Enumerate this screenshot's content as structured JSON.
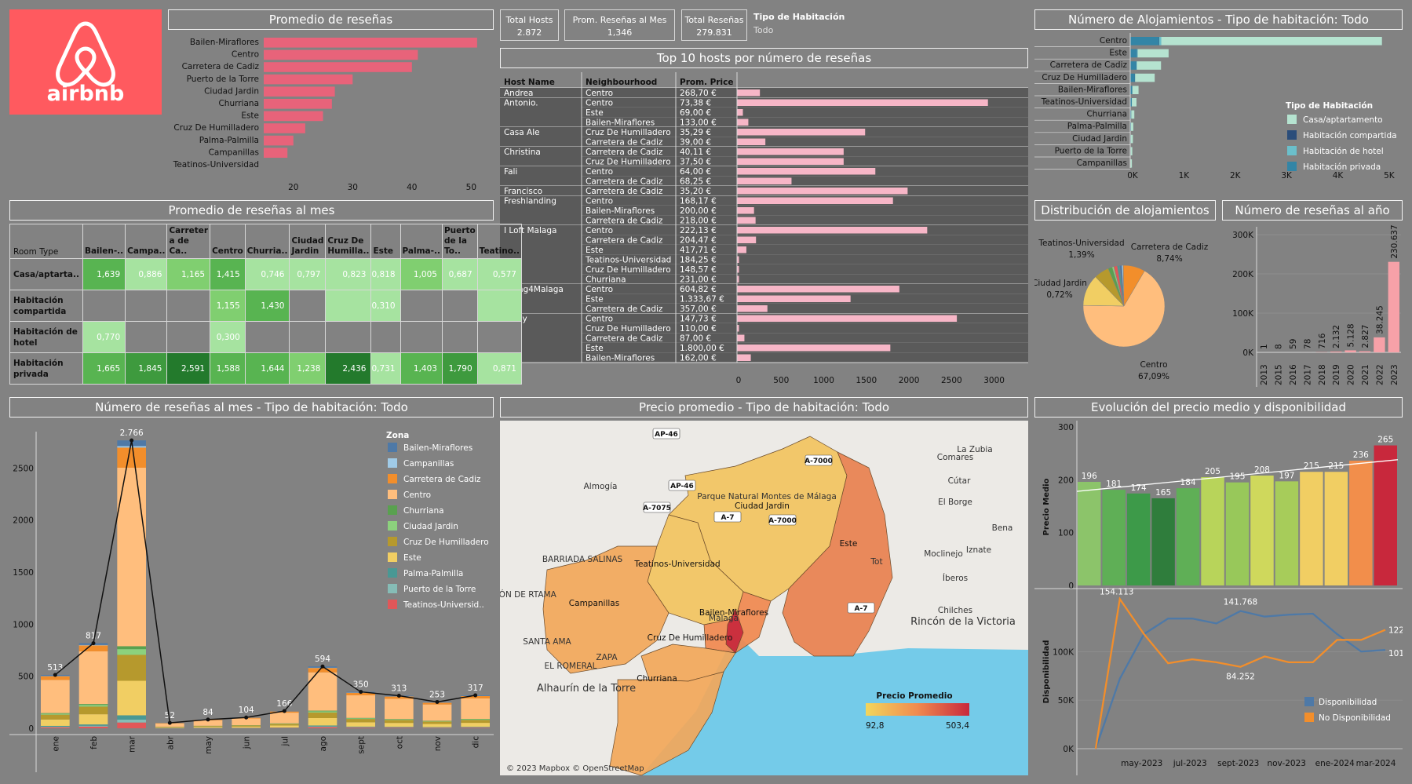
{
  "logo": {
    "text": "airbnb",
    "bg": "#ff5a5f"
  },
  "kpis": [
    {
      "label": "Total Hosts",
      "value": "2.872"
    },
    {
      "label": "Prom. Reseñas al Mes",
      "value": "1,346"
    },
    {
      "label": "Total Reseñas",
      "value": "279.831"
    }
  ],
  "room_filter": {
    "label": "Tipo de Habitación",
    "value": "Todo"
  },
  "panels": {
    "avg_reviews": "Promedio de reseñas",
    "avg_reviews_month": "Promedio de reseñas al mes",
    "reviews_month": "Número de reseñas al mes - Tipo de habitación: Todo",
    "top_hosts": "Top 10 hosts por número de reseñas",
    "map": "Precio promedio - Tipo de habitación: Todo",
    "accommodations": "Número de Alojamientos - Tipo de habitación: Todo",
    "distribution": "Distribución de alojamientos",
    "reviews_year": "Número de reseñas al año",
    "price_evolution": "Evolución del precio medio y disponibilidad"
  },
  "chart_data": [
    {
      "id": "avg_reviews",
      "type": "bar",
      "orientation": "horizontal",
      "categories": [
        "Bailen-Miraflores",
        "Centro",
        "Carretera de Cadiz",
        "Puerto de la Torre",
        "Ciudad Jardin",
        "Churriana",
        "Este",
        "Cruz De Humilladero",
        "Palma-Palmilla",
        "Campanillas",
        "Teatinos-Universidad"
      ],
      "values": [
        51,
        41,
        40,
        30,
        27,
        26.5,
        25,
        22,
        20,
        19,
        15
      ],
      "xticks": [
        "20",
        "30",
        "40",
        "50"
      ],
      "xlim": [
        15,
        53
      ],
      "color": "#e8637a"
    },
    {
      "id": "reviews_month",
      "type": "bar",
      "stacked": true,
      "categories": [
        "ene",
        "feb",
        "mar",
        "abr",
        "may",
        "jun",
        "jul",
        "ago",
        "sept",
        "oct",
        "nov",
        "dic"
      ],
      "totals": [
        513,
        817,
        2766,
        52,
        84,
        104,
        166,
        594,
        350,
        313,
        253,
        317
      ],
      "total_labels": [
        "513",
        "817",
        "2.766",
        "52",
        "84",
        "104",
        "166",
        "594",
        "350",
        "313",
        "253",
        "317"
      ],
      "yticks": [
        "0",
        "500",
        "1000",
        "1500",
        "2000",
        "2500"
      ],
      "ylim": [
        0,
        2850
      ],
      "legend_title": "Zona",
      "series": [
        {
          "name": "Bailen-Miraflores",
          "color": "#4e79a7",
          "share": 0.02
        },
        {
          "name": "Campanillas",
          "color": "#a0cbe8",
          "share": 0.005
        },
        {
          "name": "Carretera de Cadiz",
          "color": "#f28e2b",
          "share": 0.07
        },
        {
          "name": "Centro",
          "color": "#ffbe7d",
          "share": 0.62
        },
        {
          "name": "Churriana",
          "color": "#59a14f",
          "share": 0.01
        },
        {
          "name": "Ciudad Jardin",
          "color": "#8cd17d",
          "share": 0.02
        },
        {
          "name": "Cruz De Humilladero",
          "color": "#b6992d",
          "share": 0.09
        },
        {
          "name": "Este",
          "color": "#f1ce63",
          "share": 0.12
        },
        {
          "name": "Palma-Palmilla",
          "color": "#499894",
          "share": 0.015
        },
        {
          "name": "Puerto de la Torre",
          "color": "#86bcb6",
          "share": 0.01
        },
        {
          "name": "Teatinos-Universid..",
          "color": "#e15759",
          "share": 0.02
        }
      ]
    },
    {
      "id": "top_hosts",
      "type": "bar",
      "orientation": "horizontal",
      "columns": [
        "Host Name",
        "Neighbourhood",
        "Prom. Price"
      ],
      "hosts": [
        {
          "name": "Andrea",
          "rows": [
            [
              "Centro",
              "268,70 €",
              268.7
            ]
          ]
        },
        {
          "name": "Antonio.",
          "rows": [
            [
              "Centro",
              "73,38 €",
              2946
            ],
            [
              "Este",
              "69,00 €",
              69
            ],
            [
              "Bailen-Miraflores",
              "133,00 €",
              133
            ]
          ]
        },
        {
          "name": "Casa Ale",
          "rows": [
            [
              "Cruz De Humilladero",
              "35,29 €",
              1504
            ],
            [
              "Carretera de Cadiz",
              "39,00 €",
              333
            ]
          ]
        },
        {
          "name": "Christina",
          "rows": [
            [
              "Carretera de Cadiz",
              "40,11 €",
              1252
            ],
            [
              "Cruz De Humilladero",
              "37,50 €",
              1252
            ]
          ]
        },
        {
          "name": "Fali",
          "rows": [
            [
              "Centro",
              "64,00 €",
              1624
            ],
            [
              "Carretera de Cadiz",
              "68,25 €",
              640
            ]
          ]
        },
        {
          "name": "Francisco",
          "rows": [
            [
              "Carretera de Cadiz",
              "35,20 €",
              2003
            ]
          ]
        },
        {
          "name": "Freshlanding",
          "rows": [
            [
              "Centro",
              "168,17 €",
              1831
            ],
            [
              "Bailen-Miraflores",
              "200,00 €",
              200
            ],
            [
              "Carretera de Cadiz",
              "218,00 €",
              218
            ]
          ]
        },
        {
          "name": "I Loft Malaga",
          "rows": [
            [
              "Centro",
              "222,13 €",
              2233
            ],
            [
              "Carretera de Cadiz",
              "204,47 €",
              223
            ],
            [
              "Este",
              "417,71 €",
              110
            ],
            [
              "Teatinos-Universidad",
              "184,25 €",
              23
            ],
            [
              "Cruz De Humilladero",
              "148,57 €",
              23
            ],
            [
              "Churriana",
              "231,00 €",
              23
            ]
          ]
        },
        {
          "name": "Living4Malaga",
          "rows": [
            [
              "Centro",
              "604,82 €",
              1906
            ],
            [
              "Este",
              "1.333,67 €",
              1333
            ],
            [
              "Carretera de Cadiz",
              "357,00 €",
              357
            ]
          ]
        },
        {
          "name": "Remy",
          "rows": [
            [
              "Centro",
              "147,73 €",
              2581
            ],
            [
              "Cruz De Humilladero",
              "110,00 €",
              23
            ],
            [
              "Carretera de Cadiz",
              "87,00 €",
              87
            ],
            [
              "Este",
              "1.800,00 €",
              1800
            ],
            [
              "Bailen-Miraflores",
              "162,00 €",
              162
            ]
          ]
        }
      ],
      "xticks": [
        "0",
        "500",
        "1000",
        "1500",
        "2000",
        "2500",
        "3000"
      ],
      "xlim": [
        0,
        3400
      ],
      "color": "#f7b6c7"
    },
    {
      "id": "accommodations",
      "type": "bar",
      "orientation": "horizontal",
      "stacked": true,
      "categories": [
        "Centro",
        "Este",
        "Carretera de Cadiz",
        "Cruz De Humilladero",
        "Bailen-Miraflores",
        "Teatinos-Universidad",
        "Churriana",
        "Palma-Palmilla",
        "Ciudad Jardin",
        "Puerto de la Torre",
        "Campanillas"
      ],
      "series": [
        {
          "name": "Casa/aptartamento",
          "color": "#b5e3d0",
          "values": [
            4300,
            600,
            470,
            380,
            120,
            90,
            60,
            45,
            40,
            30,
            25
          ]
        },
        {
          "name": "Habitación compartida",
          "color": "#2b4d7a",
          "values": [
            5,
            3,
            2,
            2,
            0,
            0,
            0,
            0,
            0,
            0,
            0
          ]
        },
        {
          "name": "Habitación de hotel",
          "color": "#6bbfcb",
          "values": [
            40,
            15,
            8,
            5,
            2,
            2,
            0,
            0,
            0,
            0,
            0
          ]
        },
        {
          "name": "Habitación privada",
          "color": "#3385a6",
          "values": [
            560,
            130,
            120,
            90,
            40,
            30,
            20,
            15,
            12,
            10,
            8
          ]
        }
      ],
      "legend_title": "Tipo de Habitación",
      "xticks": [
        "0K",
        "1K",
        "2K",
        "3K",
        "4K",
        "5K"
      ],
      "xlim": [
        0,
        5200
      ]
    },
    {
      "id": "distribution",
      "type": "pie",
      "slices": [
        {
          "name": "Centro",
          "value": 67.09,
          "color": "#ffbe7d"
        },
        {
          "name": "Este",
          "value": 12.5,
          "color": "#f1ce63"
        },
        {
          "name": "Cruz De Humilladero",
          "value": 6.0,
          "color": "#b6992d"
        },
        {
          "name": "Churriana",
          "value": 1.6,
          "color": "#59a14f"
        },
        {
          "name": "Ciudad Jardin",
          "value": 0.72,
          "color": "#8cd17d"
        },
        {
          "name": "Teatinos-Universidad",
          "value": 1.39,
          "color": "#e15759"
        },
        {
          "name": "Palma-Palmilla",
          "value": 0.9,
          "color": "#499894"
        },
        {
          "name": "Bailen-Miraflores",
          "value": 0.9,
          "color": "#4e79a7"
        },
        {
          "name": "Campanillas",
          "value": 0.56,
          "color": "#a0cbe8"
        },
        {
          "name": "Carretera de Cadiz",
          "value": 8.74,
          "color": "#f28e2b"
        }
      ],
      "labels": [
        {
          "name": "Teatinos-Universidad",
          "pct": "1,39%"
        },
        {
          "name": "Carretera de Cadiz",
          "pct": "8,74%"
        },
        {
          "name": "Ciudad Jardin",
          "pct": "0,72%"
        },
        {
          "name": "Centro",
          "pct": "67,09%"
        }
      ]
    },
    {
      "id": "reviews_year",
      "type": "bar",
      "categories": [
        "2013",
        "2015",
        "2016",
        "2017",
        "2018",
        "2019",
        "2020",
        "2021",
        "2022",
        "2023"
      ],
      "values": [
        1,
        8,
        59,
        78,
        716,
        2132,
        5128,
        2827,
        38245,
        230637
      ],
      "labels": [
        "1",
        "8",
        "59",
        "78",
        "716",
        "2.132",
        "5.128",
        "2.827",
        "38.245",
        "230.637"
      ],
      "yticks": [
        "0K",
        "100K",
        "200K",
        "300K"
      ],
      "ylim": [
        0,
        320000
      ],
      "color": "#f7a1a8"
    },
    {
      "id": "price_evolution",
      "type": "bar",
      "values": [
        196,
        181,
        174,
        165,
        184,
        205,
        195,
        208,
        197,
        215,
        215,
        236,
        265
      ],
      "colors": [
        "#8cc46a",
        "#5faf56",
        "#3d9a49",
        "#2f7d3c",
        "#5faf56",
        "#b8d45a",
        "#98c85a",
        "#cfd85c",
        "#a7cc5a",
        "#f1ce63",
        "#f1ce63",
        "#f28e4b",
        "#c8283c"
      ],
      "yticks": [
        "0",
        "100",
        "200",
        "300"
      ],
      "ylim": [
        0,
        300
      ],
      "ylabel": "Precio Medio"
    },
    {
      "id": "availability",
      "type": "line",
      "xticks": [
        "may-2023",
        "jul-2023",
        "sept-2023",
        "nov-2023",
        "ene-2024",
        "mar-2024"
      ],
      "yticks": [
        "0K",
        "50K",
        "100K"
      ],
      "ylim": [
        0,
        160000
      ],
      "ylabel": "Disponibilidad",
      "series": [
        {
          "name": "Disponibilidad",
          "color": "#4e79a7",
          "values": [
            0,
            72000,
            118000,
            134000,
            134000,
            129000,
            141768,
            136000,
            138000,
            139000,
            118000,
            100000,
            101726
          ]
        },
        {
          "name": "No Disponibilidad",
          "color": "#f28e2b",
          "values": [
            0,
            154113,
            118000,
            88000,
            92000,
            89000,
            84252,
            95000,
            89000,
            89000,
            112000,
            112000,
            122403
          ]
        }
      ],
      "annotations": [
        "154.113",
        "141.768",
        "84.252",
        "122.403",
        "101.726"
      ]
    }
  ],
  "heatmap": {
    "row_header": "Room Type",
    "columns": [
      "Bailen-..",
      "Campa..",
      "Carreter a de Ca..",
      "Centro",
      "Churria..",
      "Ciudad Jardin",
      "Cruz De Humilla..",
      "Este",
      "Palma-..",
      "Puerto de la To..",
      "Teatino.."
    ],
    "rows": [
      {
        "label": "Casa/aptarta..",
        "cells": [
          "1,639",
          "0,886",
          "1,165",
          "1,415",
          "0,746",
          "0,797",
          "0,823",
          "0,818",
          "1,005",
          "0,687",
          "0,577"
        ],
        "values": [
          1.639,
          0.886,
          1.165,
          1.415,
          0.746,
          0.797,
          0.823,
          0.818,
          1.005,
          0.687,
          0.577
        ]
      },
      {
        "label": "Habitación compartida",
        "cells": [
          "",
          "",
          "",
          "1,155",
          "1,430",
          "",
          "",
          "0,310",
          "",
          "",
          ""
        ],
        "values": [
          null,
          null,
          null,
          1.155,
          1.43,
          null,
          0.2,
          0.31,
          null,
          null,
          0.2
        ]
      },
      {
        "label": "Habitación de hotel",
        "cells": [
          "0,770",
          "",
          "",
          "0,300",
          "",
          "",
          "",
          "",
          "",
          "",
          ""
        ],
        "values": [
          0.77,
          null,
          null,
          0.3,
          null,
          null,
          null,
          null,
          null,
          null,
          null
        ]
      },
      {
        "label": "Habitación privada",
        "cells": [
          "1,665",
          "1,845",
          "2,591",
          "1,588",
          "1,644",
          "1,238",
          "2,436",
          "0,731",
          "1,403",
          "1,790",
          "0,871"
        ],
        "values": [
          1.665,
          1.845,
          2.591,
          1.588,
          1.644,
          1.238,
          2.436,
          0.731,
          1.403,
          1.79,
          0.871
        ]
      }
    ]
  },
  "map": {
    "districts": [
      "Ciudad Jardin",
      "Este",
      "Teatinos-Universidad",
      "Campanillas",
      "Bailen-Miraflores",
      "Cruz De Humilladero",
      "Churriana"
    ],
    "places": [
      "Almogía",
      "La Zubia",
      "Comares",
      "Cútar",
      "El Borge",
      "Moclinejo",
      "Iznate",
      "Íberos",
      "Chilches",
      "Rincón de la Victoria",
      "Alhaurín de la Torre",
      "Málaga",
      "Parque Natural Montes de Málaga",
      "BARRIADA SALINAS",
      "CIÓN DE RTAMA",
      "SANTA AMA",
      "EL ROMERAL",
      "ZAPA",
      "Tot",
      "Bena"
    ],
    "roads": [
      "AP-46",
      "AP-46",
      "A-7075",
      "A-7000",
      "A-7000",
      "A-7",
      "A-7"
    ],
    "legend_title": "Precio Promedio",
    "min": "92,8",
    "max": "503,4",
    "attribution": "© 2023 Mapbox © OpenStreetMap"
  }
}
